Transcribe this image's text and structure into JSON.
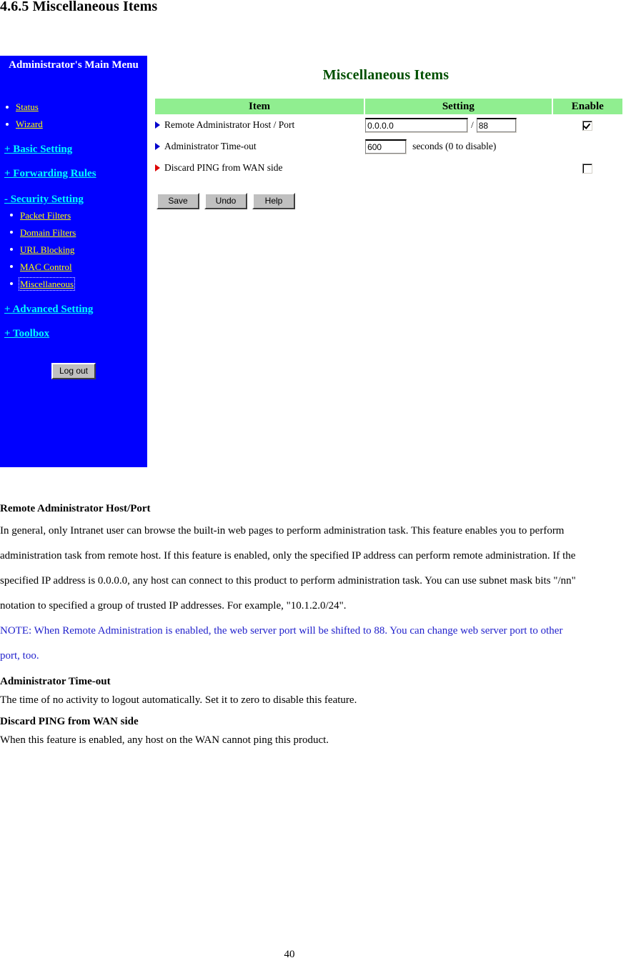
{
  "document": {
    "heading": "4.6.5 Miscellaneous Items",
    "page_number": "40"
  },
  "sidebar": {
    "title": "Administrator's Main Menu",
    "background_color": "#0000FF",
    "link_color": "#FFFF00",
    "group_link_color": "#00FFFF",
    "top_items": [
      {
        "label": "Status"
      },
      {
        "label": "Wizard"
      }
    ],
    "groups": [
      {
        "label": "+ Basic Setting",
        "expanded": false
      },
      {
        "label": "+ Forwarding Rules",
        "expanded": false
      },
      {
        "label": "- Security Setting",
        "expanded": true
      },
      {
        "label": "+ Advanced Setting",
        "expanded": false
      },
      {
        "label": "+ Toolbox",
        "expanded": false
      }
    ],
    "security_items": [
      {
        "label": "Packet Filters",
        "selected": false
      },
      {
        "label": "Domain Filters",
        "selected": false
      },
      {
        "label": "URL Blocking",
        "selected": false
      },
      {
        "label": "MAC Control",
        "selected": false
      },
      {
        "label": "Miscellaneous",
        "selected": true
      }
    ],
    "logout_label": "Log out"
  },
  "panel": {
    "title": "Miscellaneous Items",
    "title_color": "#005000",
    "header_background": "#90EE90",
    "columns": {
      "item": "Item",
      "setting": "Setting",
      "enable": "Enable"
    },
    "rows": [
      {
        "marker_color": "#0000CC",
        "label": "Remote Administrator Host / Port",
        "host_value": "0.0.0.0",
        "separator": "/",
        "port_value": "88",
        "enabled": true
      },
      {
        "marker_color": "#0000CC",
        "label": "Administrator Time-out",
        "timeout_value": "600",
        "unit_label": "seconds (0 to disable)",
        "enabled": null
      },
      {
        "marker_color": "#DD0000",
        "label": "Discard PING from WAN side",
        "enabled": false
      }
    ],
    "buttons": {
      "save": "Save",
      "undo": "Undo",
      "help": "Help"
    }
  },
  "description": {
    "section1_title": "Remote Administrator Host/Port",
    "section1_body": "In general, only Intranet user can browse the built-in web pages to perform administration task. This feature enables you to perform administration task from remote host. If this feature is enabled, only the specified IP address can perform remote administration. If the specified IP address is 0.0.0.0, any host can connect to this product to perform administration task. You can use subnet mask bits \"/nn\" notation to specified a group of trusted IP addresses. For example, \"10.1.2.0/24\".",
    "note": "NOTE: When Remote Administration is enabled, the web server port will be shifted to 88. You can change web server port to other port, too.",
    "note_color": "#2222CC",
    "section2_title": "Administrator Time-out",
    "section2_body": "The time of no activity to logout automatically. Set it to zero to disable this feature.",
    "section3_title": "Discard PING from WAN side",
    "section3_body": "When this feature is enabled, any host on the WAN cannot ping this product."
  }
}
